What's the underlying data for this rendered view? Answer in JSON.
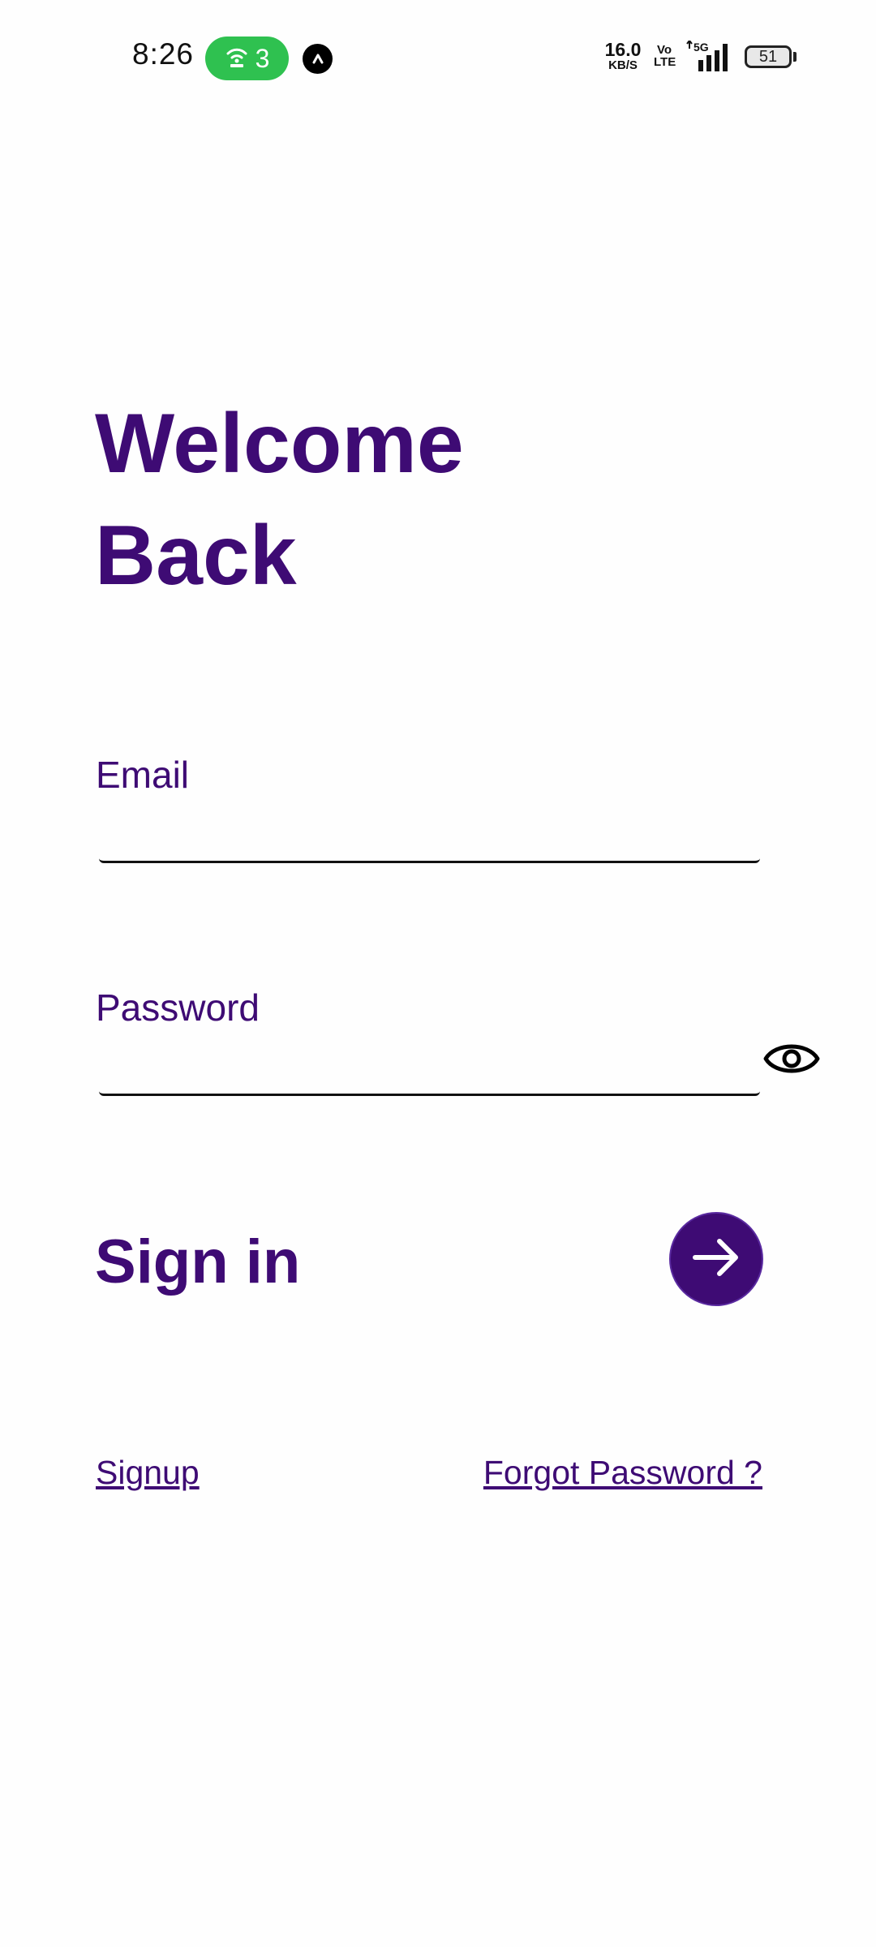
{
  "status_bar": {
    "time": "8:26",
    "hotspot_count": "3",
    "net_speed_value": "16.0",
    "net_speed_unit": "KB/S",
    "volte_top": "Vo",
    "volte_bottom": "LTE",
    "network_type": "5G",
    "battery_level": "51",
    "hotspot_color": "#2fc150"
  },
  "header": {
    "title_line1": "Welcome",
    "title_line2": "Back"
  },
  "form": {
    "email_label": "Email",
    "email_value": "",
    "password_label": "Password",
    "password_value": "",
    "password_toggle_icon": "eye-icon"
  },
  "actions": {
    "sign_in_label": "Sign in",
    "sign_in_icon": "arrow-right-icon",
    "signup_link": "Signup",
    "forgot_password_link": "Forgot Password ?"
  },
  "theme": {
    "accent_color": "#3e0b74"
  }
}
